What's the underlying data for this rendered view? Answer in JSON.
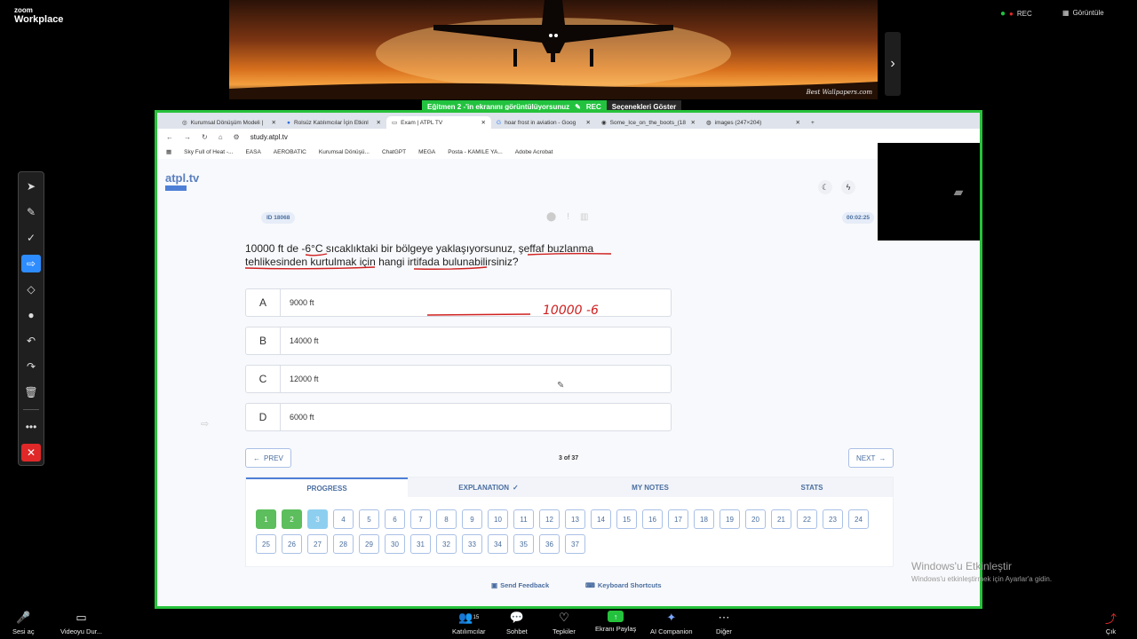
{
  "zoom": {
    "logo_line1": "zoom",
    "logo_line2": "Workplace",
    "rec": "REC",
    "view": "Görüntüle",
    "credit": "Best Wallpapers.com",
    "sharing_banner": "Eğitmen 2 -'in ekranını görüntülüyorsunuz",
    "banner_rec": "REC",
    "options": "Seçenekleri Göster",
    "windows_activate_title": "Windows'u Etkinleştir",
    "windows_activate_sub": "Windows'u etkinleştirmek için Ayarlar'a gidin.",
    "bottom": [
      {
        "label": "Sesi aç",
        "icon": "mic-muted-icon"
      },
      {
        "label": "Videoyu Dur...",
        "icon": "camera-icon"
      },
      {
        "label": "Katılımcılar",
        "icon": "participants-icon",
        "count": "15"
      },
      {
        "label": "Sohbet",
        "icon": "chat-icon"
      },
      {
        "label": "Tepkiler",
        "icon": "heart-icon"
      },
      {
        "label": "Ekranı Paylaş",
        "icon": "share-screen-icon"
      },
      {
        "label": "AI Companion",
        "icon": "sparkle-icon"
      },
      {
        "label": "Diğer",
        "icon": "more-icon"
      },
      {
        "label": "Çık",
        "icon": "exit-icon"
      }
    ]
  },
  "browser": {
    "tabs": [
      {
        "label": "Kurumsal Dönüşüm Modeli |"
      },
      {
        "label": "Rolsüz Katılımcılar İçin Etkinl"
      },
      {
        "label": "Exam | ATPL TV",
        "active": true
      },
      {
        "label": "hoar frost in aviation - Goog"
      },
      {
        "label": "Some_Ice_on_the_boots_(18"
      },
      {
        "label": "images (247×204)"
      }
    ],
    "url": "study.atpl.tv",
    "bookmarks": [
      "Sky Full of Heat -...",
      "EASA",
      "AEROBATIC",
      "Kurumsal Dönüşü...",
      "ChatGPT",
      "MEGA",
      "Posta - KAMILE YA...",
      "Adobe Acrobat"
    ]
  },
  "exam": {
    "logo": "atpl.tv",
    "id": "ID 18068",
    "timer": "00:02:25",
    "question": "10000 ft de -6°C sıcaklıktaki bir bölgeye yaklaşıyorsunuz, şeffaf buzlanma tehlikesinden kurtulmak için hangi irtifada bulunabilirsiniz?",
    "options": [
      {
        "letter": "A",
        "text": "9000 ft"
      },
      {
        "letter": "B",
        "text": "14000 ft"
      },
      {
        "letter": "C",
        "text": "12000 ft"
      },
      {
        "letter": "D",
        "text": "6000 ft"
      }
    ],
    "annotation_text": "10000 -6",
    "prev": "PREV",
    "next": "NEXT",
    "counter": "3 of 37",
    "panel_tabs": [
      "PROGRESS",
      "EXPLANATION",
      "MY NOTES",
      "STATS"
    ],
    "questions": [
      "1",
      "2",
      "3",
      "4",
      "5",
      "6",
      "7",
      "8",
      "9",
      "10",
      "11",
      "12",
      "13",
      "14",
      "15",
      "16",
      "17",
      "18",
      "19",
      "20",
      "21",
      "22",
      "23",
      "24",
      "25",
      "26",
      "27",
      "28",
      "29",
      "30",
      "31",
      "32",
      "33",
      "34",
      "35",
      "36",
      "37"
    ],
    "done": [
      "1",
      "2"
    ],
    "current": "3",
    "send_feedback": "Send Feedback",
    "keyboard_shortcuts": "Keyboard Shortcuts"
  },
  "colors": {
    "accent": "#4e7fd6",
    "share_border": "#27c23b",
    "done": "#5cbe5c",
    "current": "#8ecff0",
    "annotation_red": "#d02020"
  }
}
